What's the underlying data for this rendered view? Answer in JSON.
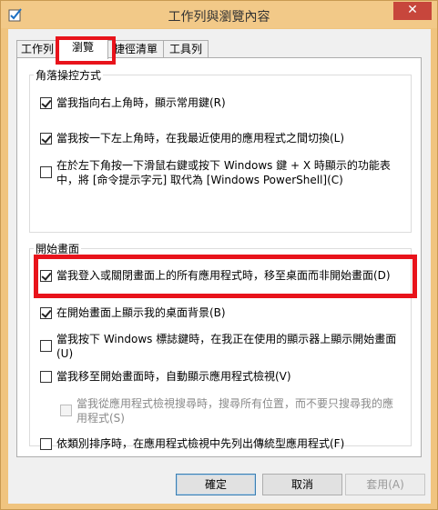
{
  "window": {
    "title": "工作列與瀏覽內容",
    "close_label": "✕"
  },
  "tabs": [
    {
      "label": "工作列"
    },
    {
      "label": "瀏覽"
    },
    {
      "label": "捷徑清單"
    },
    {
      "label": "工具列"
    }
  ],
  "corner": {
    "title": "角落操控方式",
    "opt1": "當我指向右上角時，顯示常用鍵(R)",
    "opt2": "當我按一下左上角時，在我最近使用的應用程式之間切換(L)",
    "opt3_line1": "在於左下角按一下滑鼠右鍵或按下 Windows 鍵 + X 時顯示的功能表",
    "opt3_line2": "中，將 [命令提示字元] 取代為 [Windows PowerShell](C)"
  },
  "start": {
    "title": "開始畫面",
    "opt1": "當我登入或關閉畫面上的所有應用程式時，移至桌面而非開始畫面(D)",
    "opt2": "在開始畫面上顯示我的桌面背景(B)",
    "opt3_line1": "當我按下 Windows 標誌鍵時，在我正在使用的顯示器上顯示開始畫面",
    "opt3_line2": "(U)",
    "opt4": "當我移至開始畫面時，自動顯示應用程式檢視(V)",
    "opt5_line1": "當我從應用程式檢視搜尋時，搜尋所有位置，而不要只搜尋我的應",
    "opt5_line2": "用程式(S)",
    "opt6": "依類別排序時，在應用程式檢視中先列出傳統型應用程式(F)"
  },
  "buttons": {
    "ok": "確定",
    "cancel": "取消",
    "apply": "套用(A)"
  }
}
